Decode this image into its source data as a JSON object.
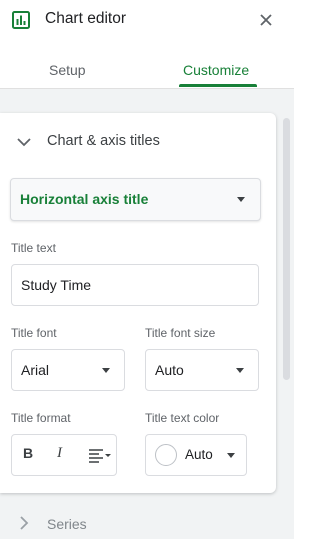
{
  "header": {
    "title": "Chart editor",
    "app_icon": "chart-icon",
    "close_icon": "close-icon"
  },
  "tabs": [
    {
      "label": "Setup",
      "active": false
    },
    {
      "label": "Customize",
      "active": true
    }
  ],
  "accent_color": "#188038",
  "section": {
    "title": "Chart & axis titles",
    "expanded": true,
    "title_type_dropdown": {
      "value": "Horizontal axis title"
    },
    "title_text": {
      "label": "Title text",
      "value": "Study Time"
    },
    "title_font": {
      "label": "Title font",
      "value": "Arial"
    },
    "title_font_size": {
      "label": "Title font size",
      "value": "Auto"
    },
    "title_format": {
      "label": "Title format",
      "buttons": [
        "B",
        "I",
        "align-icon"
      ]
    },
    "title_text_color": {
      "label": "Title text color",
      "value": "Auto"
    }
  },
  "collapsed_sections": [
    {
      "title": "Series"
    }
  ]
}
